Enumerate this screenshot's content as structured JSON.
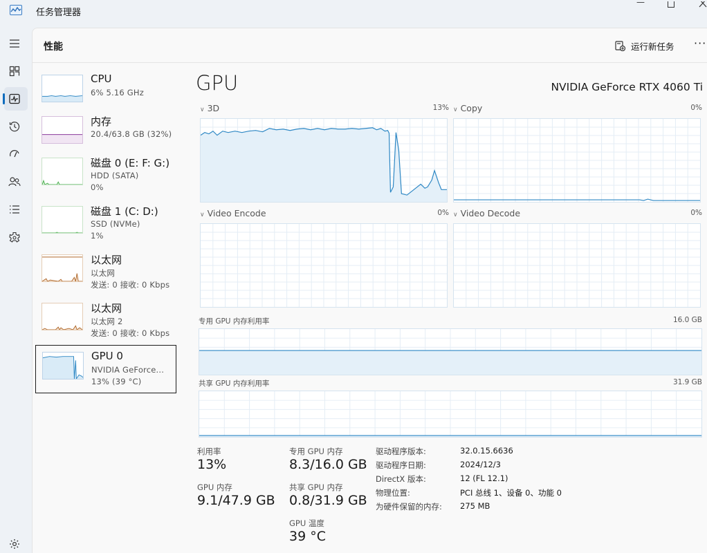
{
  "window": {
    "title": "任务管理器"
  },
  "header": {
    "page_title": "性能",
    "run_task_label": "运行新任务",
    "more_label": "···"
  },
  "devices": [
    {
      "name": "CPU",
      "line1": "6%  5.16 GHz",
      "line2": "",
      "line3": ""
    },
    {
      "name": "内存",
      "line1": "20.4/63.8 GB (32%)",
      "line2": "",
      "line3": ""
    },
    {
      "name": "磁盘 0 (E: F: G:)",
      "line1": "HDD (SATA)",
      "line2": "0%",
      "line3": ""
    },
    {
      "name": "磁盘 1 (C: D:)",
      "line1": "SSD (NVMe)",
      "line2": "1%",
      "line3": ""
    },
    {
      "name": "以太网",
      "line1": "以太网",
      "line2": "发送: 0 接收: 0 Kbps",
      "line3": ""
    },
    {
      "name": "以太网",
      "line1": "以太网 2",
      "line2": "发送: 0 接收: 0 Kbps",
      "line3": ""
    },
    {
      "name": "GPU 0",
      "line1": "NVIDIA GeForce...",
      "line2": "13% (39 °C)",
      "line3": ""
    }
  ],
  "gpu": {
    "title": "GPU",
    "model": "NVIDIA GeForce RTX 4060 Ti",
    "engines": [
      {
        "label": "3D",
        "percent": "13%"
      },
      {
        "label": "Copy",
        "percent": "0%"
      },
      {
        "label": "Video Encode",
        "percent": "0%"
      },
      {
        "label": "Video Decode",
        "percent": "0%"
      }
    ],
    "dedicated_mem_label": "专用 GPU 内存利用率",
    "dedicated_mem_max": "16.0 GB",
    "shared_mem_label": "共享 GPU 内存利用率",
    "shared_mem_max": "31.9 GB"
  },
  "stats": {
    "utilization_label": "利用率",
    "utilization": "13%",
    "gpu_mem_label": "GPU 内存",
    "gpu_mem": "9.1/47.9 GB",
    "dedicated_label": "专用 GPU 内存",
    "dedicated": "8.3/16.0 GB",
    "shared_label": "共享 GPU 内存",
    "shared": "0.8/31.9 GB",
    "temp_label": "GPU 温度",
    "temp": "39 °C"
  },
  "details": [
    {
      "key": "驱动程序版本:",
      "value": "32.0.15.6636"
    },
    {
      "key": "驱动程序日期:",
      "value": "2024/12/3"
    },
    {
      "key": "DirectX 版本:",
      "value": "12 (FL 12.1)"
    },
    {
      "key": "物理位置:",
      "value": "PCI 总线 1、设备 0、功能 0"
    },
    {
      "key": "为硬件保留的内存:",
      "value": "275 MB"
    }
  ],
  "colors": {
    "accent": "#0f6cbd",
    "gpu_line": "#2d87c4",
    "mem_line": "#8a3a9c",
    "disk_line": "#4caf50",
    "net_line": "#b0682a"
  }
}
